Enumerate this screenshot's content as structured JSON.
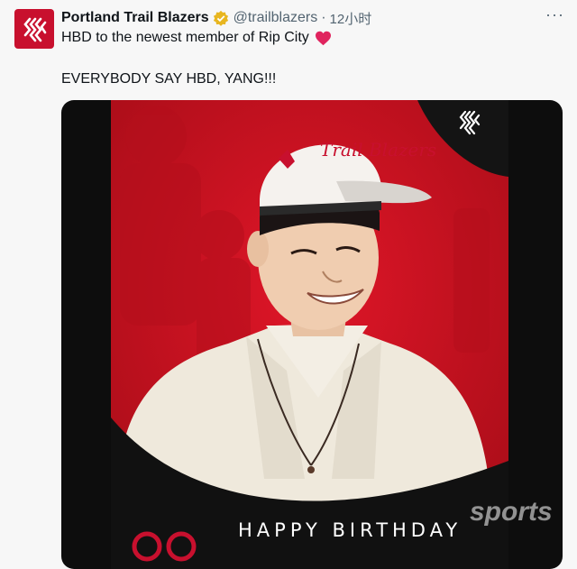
{
  "tweet": {
    "display_name": "Portland Trail Blazers",
    "handle": "@trailblazers",
    "separator": "·",
    "time": "12小时",
    "more_label": "···",
    "line1": "HBD to the newest member of Rip City",
    "line2": "EVERYBODY SAY HBD, YANG!!!"
  },
  "media": {
    "cap_text": "Trail Blazers",
    "caption": "HAPPY BIRTHDAY",
    "watermark": "sports"
  },
  "colors": {
    "brand_red": "#c8102e",
    "poster_red": "#d01220",
    "verified_gold": "#e8b620",
    "heart_red": "#f91880"
  }
}
